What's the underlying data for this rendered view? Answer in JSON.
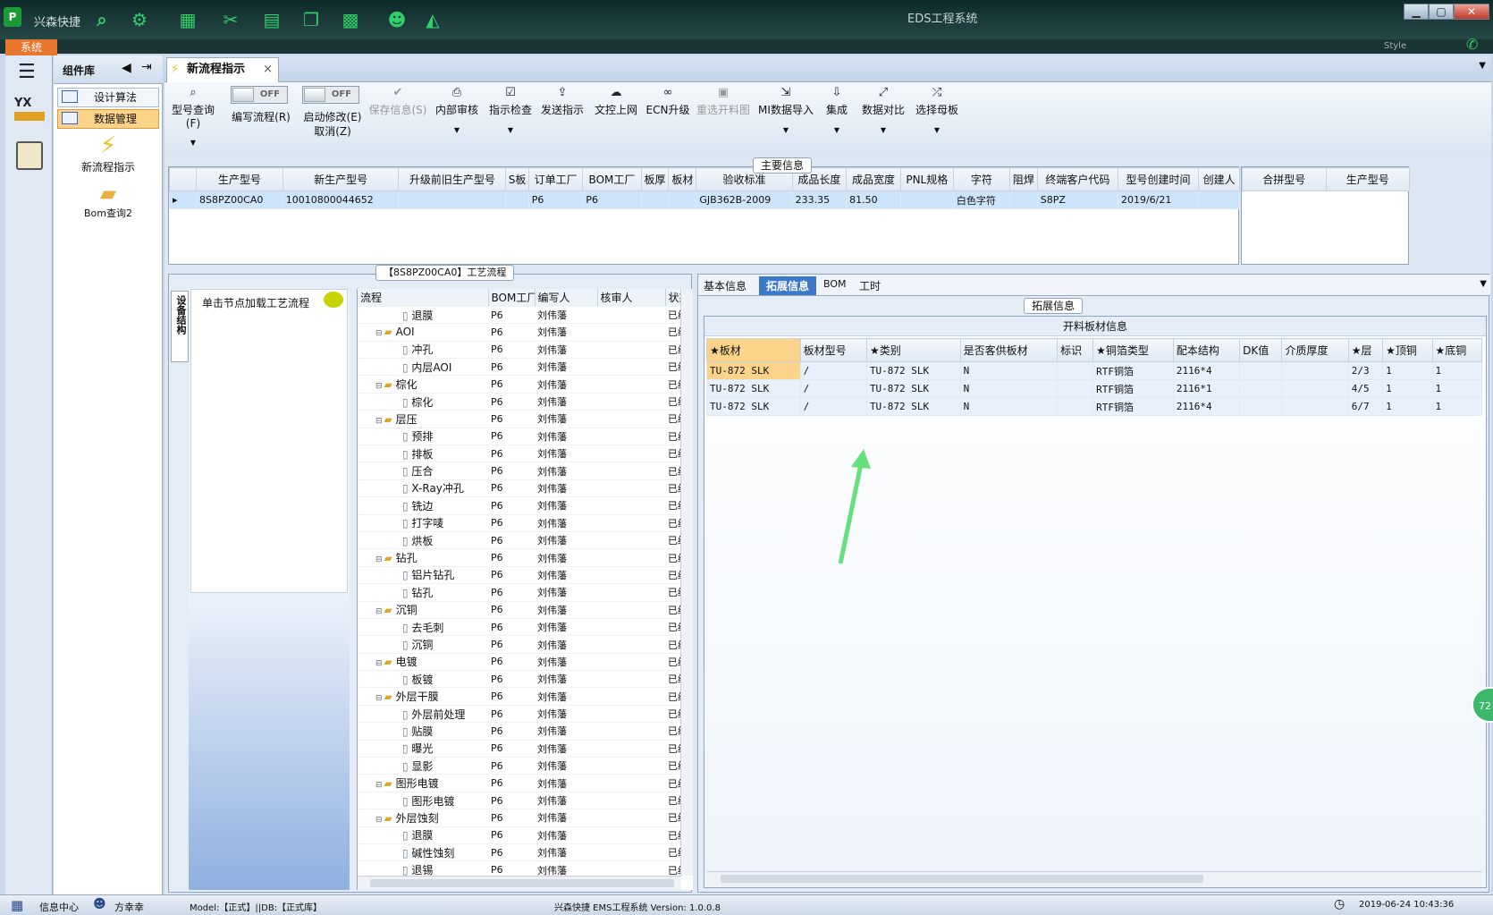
{
  "window": {
    "app_name": "兴森快捷",
    "title": "EDS工程系统",
    "system_tab": "系统",
    "style_label": "Style"
  },
  "component_library": {
    "title": "组件库",
    "items": [
      "设计算法",
      "数据管理"
    ],
    "tools": [
      "新流程指示",
      "Bom查询2"
    ]
  },
  "tab": {
    "label": "新流程指示"
  },
  "ribbon": {
    "model_query": "型号查询(F)",
    "write_flow_toggle": "OFF",
    "write_flow": "编写流程(R)",
    "start_modify_toggle": "OFF",
    "start_modify": "启动修改(E)",
    "cancel": "取消(Z)",
    "save_info": "保存信息(S)",
    "internal_review": "内部审核",
    "instruction_check": "指示检查",
    "send_instruction": "发送指示",
    "file_upload": "文控上网",
    "ecn_upgrade": "ECN升级",
    "reselect_cutting": "重选开料图",
    "mi_import": "MI数据导入",
    "integration": "集成",
    "data_compare": "数据对比",
    "select_mother": "选择母板"
  },
  "main_info": {
    "title": "主要信息",
    "columns": [
      "生产型号",
      "新生产型号",
      "升级前旧生产型号",
      "S板",
      "订单工厂",
      "BOM工厂",
      "板厚",
      "板材",
      "验收标准",
      "成品长度",
      "成品宽度",
      "PNL规格",
      "字符",
      "阻焊",
      "终端客户代码",
      "型号创建时间",
      "创建人"
    ],
    "row": [
      "8S8PZ00CA0",
      "10010800044652",
      "",
      "",
      "P6",
      "P6",
      "",
      "",
      "GJB362B-2009",
      "233.35",
      "81.50",
      "",
      "白色字符",
      "",
      "S8PZ",
      "2019/6/21",
      ""
    ],
    "side_columns": [
      "合拼型号",
      "生产型号"
    ]
  },
  "process": {
    "title": "【8S8PZ00CA0】工艺流程",
    "vertical_tab": "设备结构",
    "load_hint": "单击节点加载工艺流程",
    "columns": [
      "流程",
      "BOM工厂",
      "编写人",
      "核审人",
      "状态"
    ],
    "rows": [
      {
        "name": "退膜",
        "level": 2,
        "bom": "P6",
        "writer": "刘伟藩",
        "status": "已编写"
      },
      {
        "name": "AOI",
        "level": 1,
        "bom": "P6",
        "writer": "刘伟藩",
        "status": "已编写"
      },
      {
        "name": "冲孔",
        "level": 2,
        "bom": "P6",
        "writer": "刘伟藩",
        "status": "已编写"
      },
      {
        "name": "内层AOI",
        "level": 2,
        "bom": "P6",
        "writer": "刘伟藩",
        "status": "已编写"
      },
      {
        "name": "棕化",
        "level": 1,
        "bom": "P6",
        "writer": "刘伟藩",
        "status": "已编写"
      },
      {
        "name": "棕化",
        "level": 2,
        "bom": "P6",
        "writer": "刘伟藩",
        "status": "已编写"
      },
      {
        "name": "层压",
        "level": 1,
        "bom": "P6",
        "writer": "刘伟藩",
        "status": "已编写"
      },
      {
        "name": "预排",
        "level": 2,
        "bom": "P6",
        "writer": "刘伟藩",
        "status": "已编写"
      },
      {
        "name": "排板",
        "level": 2,
        "bom": "P6",
        "writer": "刘伟藩",
        "status": "已编写"
      },
      {
        "name": "压合",
        "level": 2,
        "bom": "P6",
        "writer": "刘伟藩",
        "status": "已编写"
      },
      {
        "name": "X-Ray冲孔",
        "level": 2,
        "bom": "P6",
        "writer": "刘伟藩",
        "status": "已编写"
      },
      {
        "name": "铣边",
        "level": 2,
        "bom": "P6",
        "writer": "刘伟藩",
        "status": "已编写"
      },
      {
        "name": "打字唛",
        "level": 2,
        "bom": "P6",
        "writer": "刘伟藩",
        "status": "已编写"
      },
      {
        "name": "烘板",
        "level": 2,
        "bom": "P6",
        "writer": "刘伟藩",
        "status": "已编写"
      },
      {
        "name": "钻孔",
        "level": 1,
        "bom": "P6",
        "writer": "刘伟藩",
        "status": "已编写"
      },
      {
        "name": "铝片钻孔",
        "level": 2,
        "bom": "P6",
        "writer": "刘伟藩",
        "status": "已编写"
      },
      {
        "name": "钻孔",
        "level": 2,
        "bom": "P6",
        "writer": "刘伟藩",
        "status": "已编写"
      },
      {
        "name": "沉铜",
        "level": 1,
        "bom": "P6",
        "writer": "刘伟藩",
        "status": "已编写"
      },
      {
        "name": "去毛刺",
        "level": 2,
        "bom": "P6",
        "writer": "刘伟藩",
        "status": "已编写"
      },
      {
        "name": "沉铜",
        "level": 2,
        "bom": "P6",
        "writer": "刘伟藩",
        "status": "已编写"
      },
      {
        "name": "电镀",
        "level": 1,
        "bom": "P6",
        "writer": "刘伟藩",
        "status": "已编写"
      },
      {
        "name": "板镀",
        "level": 2,
        "bom": "P6",
        "writer": "刘伟藩",
        "status": "已编写"
      },
      {
        "name": "外层干膜",
        "level": 1,
        "bom": "P6",
        "writer": "刘伟藩",
        "status": "已编写"
      },
      {
        "name": "外层前处理",
        "level": 2,
        "bom": "P6",
        "writer": "刘伟藩",
        "status": "已编写"
      },
      {
        "name": "贴膜",
        "level": 2,
        "bom": "P6",
        "writer": "刘伟藩",
        "status": "已编写"
      },
      {
        "name": "曝光",
        "level": 2,
        "bom": "P6",
        "writer": "刘伟藩",
        "status": "已编写"
      },
      {
        "name": "显影",
        "level": 2,
        "bom": "P6",
        "writer": "刘伟藩",
        "status": "已编写"
      },
      {
        "name": "图形电镀",
        "level": 1,
        "bom": "P6",
        "writer": "刘伟藩",
        "status": "已编写"
      },
      {
        "name": "图形电镀",
        "level": 2,
        "bom": "P6",
        "writer": "刘伟藩",
        "status": "已编写"
      },
      {
        "name": "外层蚀刻",
        "level": 1,
        "bom": "P6",
        "writer": "刘伟藩",
        "status": "已编写"
      },
      {
        "name": "退膜",
        "level": 2,
        "bom": "P6",
        "writer": "刘伟藩",
        "status": "已编写"
      },
      {
        "name": "碱性蚀刻",
        "level": 2,
        "bom": "P6",
        "writer": "刘伟藩",
        "status": "已编写"
      },
      {
        "name": "退锡",
        "level": 2,
        "bom": "P6",
        "writer": "刘伟藩",
        "status": "已编写"
      }
    ]
  },
  "detail_tabs": [
    "基本信息",
    "拓展信息",
    "BOM",
    "工时"
  ],
  "extended": {
    "title": "拓展信息",
    "sub_title": "开料板材信息",
    "columns": [
      "★板材",
      "板材型号",
      "★类别",
      "是否客供板材",
      "标识",
      "★铜箔类型",
      "配本结构",
      "DK值",
      "介质厚度",
      "★层",
      "★顶铜",
      "★底铜"
    ],
    "rows": [
      [
        "TU-872 SLK",
        "/",
        "TU-872 SLK",
        "N",
        "",
        "RTF铜箔",
        "2116*4",
        "",
        "",
        "2/3",
        "1",
        "1"
      ],
      [
        "TU-872 SLK",
        "/",
        "TU-872 SLK",
        "N",
        "",
        "RTF铜箔",
        "2116*1",
        "",
        "",
        "4/5",
        "1",
        "1"
      ],
      [
        "TU-872 SLK",
        "/",
        "TU-872 SLK",
        "N",
        "",
        "RTF铜箔",
        "2116*4",
        "",
        "",
        "6/7",
        "1",
        "1"
      ]
    ]
  },
  "float_badge": "72",
  "status": {
    "info_center": "信息中心",
    "user": "方幸幸",
    "model_db": "Model:【正式】||DB:【正式库】",
    "version": "兴森快捷 EMS工程系统 Version: 1.0.0.8",
    "datetime": "2019-06-24 10:43:36"
  },
  "colors": {
    "accent_orange": "#e8762e",
    "selection": "#cde4fb",
    "highlight": "#fbd48a",
    "arrow_green": "#66e07a"
  }
}
